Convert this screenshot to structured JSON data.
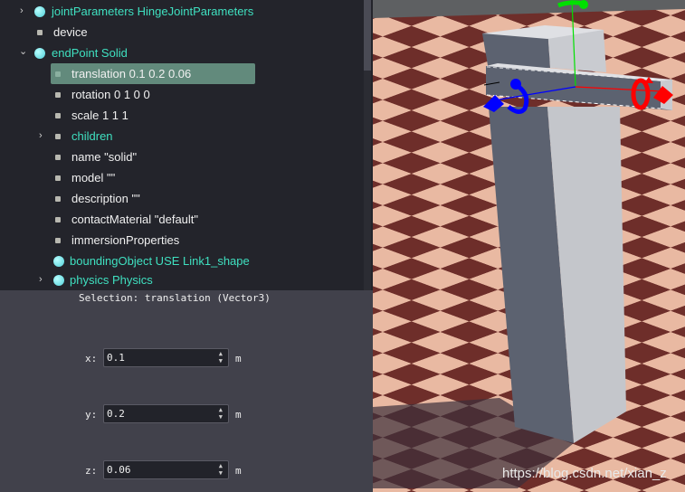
{
  "tree": {
    "rows": [
      {
        "label": "jointParameters HingeJointParameters",
        "kind": "node",
        "expander": "collapsed"
      },
      {
        "label": "device",
        "kind": "field"
      },
      {
        "label": "endPoint Solid",
        "kind": "node",
        "expander": "expanded"
      },
      {
        "label": "translation 0.1 0.2 0.06",
        "kind": "field",
        "selected": true
      },
      {
        "label": "rotation 0 1 0 0",
        "kind": "field"
      },
      {
        "label": "scale 1 1 1",
        "kind": "field"
      },
      {
        "label": "children",
        "kind": "field-mf",
        "expander": "collapsed"
      },
      {
        "label": "name \"solid\"",
        "kind": "field"
      },
      {
        "label": "model \"\"",
        "kind": "field"
      },
      {
        "label": "description \"\"",
        "kind": "field"
      },
      {
        "label": "contactMaterial \"default\"",
        "kind": "field"
      },
      {
        "label": "immersionProperties",
        "kind": "field"
      },
      {
        "label": "boundingObject USE Link1_shape",
        "kind": "node"
      },
      {
        "label": "physics Physics",
        "kind": "node",
        "expander": "collapsed"
      }
    ]
  },
  "props": {
    "title": "Selection: translation (Vector3)",
    "fields": [
      {
        "label": "x:",
        "value": "0.1",
        "unit": "m"
      },
      {
        "label": "y:",
        "value": "0.2",
        "unit": "m"
      },
      {
        "label": "z:",
        "value": "0.06",
        "unit": "m"
      }
    ]
  },
  "view": {
    "watermark": "https://blog.csdn.net/xian_z"
  },
  "colors": {
    "node": "#3fe0c0",
    "selection": "#628a7c",
    "x_axis": "#ff0000",
    "y_axis": "#00e000",
    "z_axis": "#0000ff"
  }
}
